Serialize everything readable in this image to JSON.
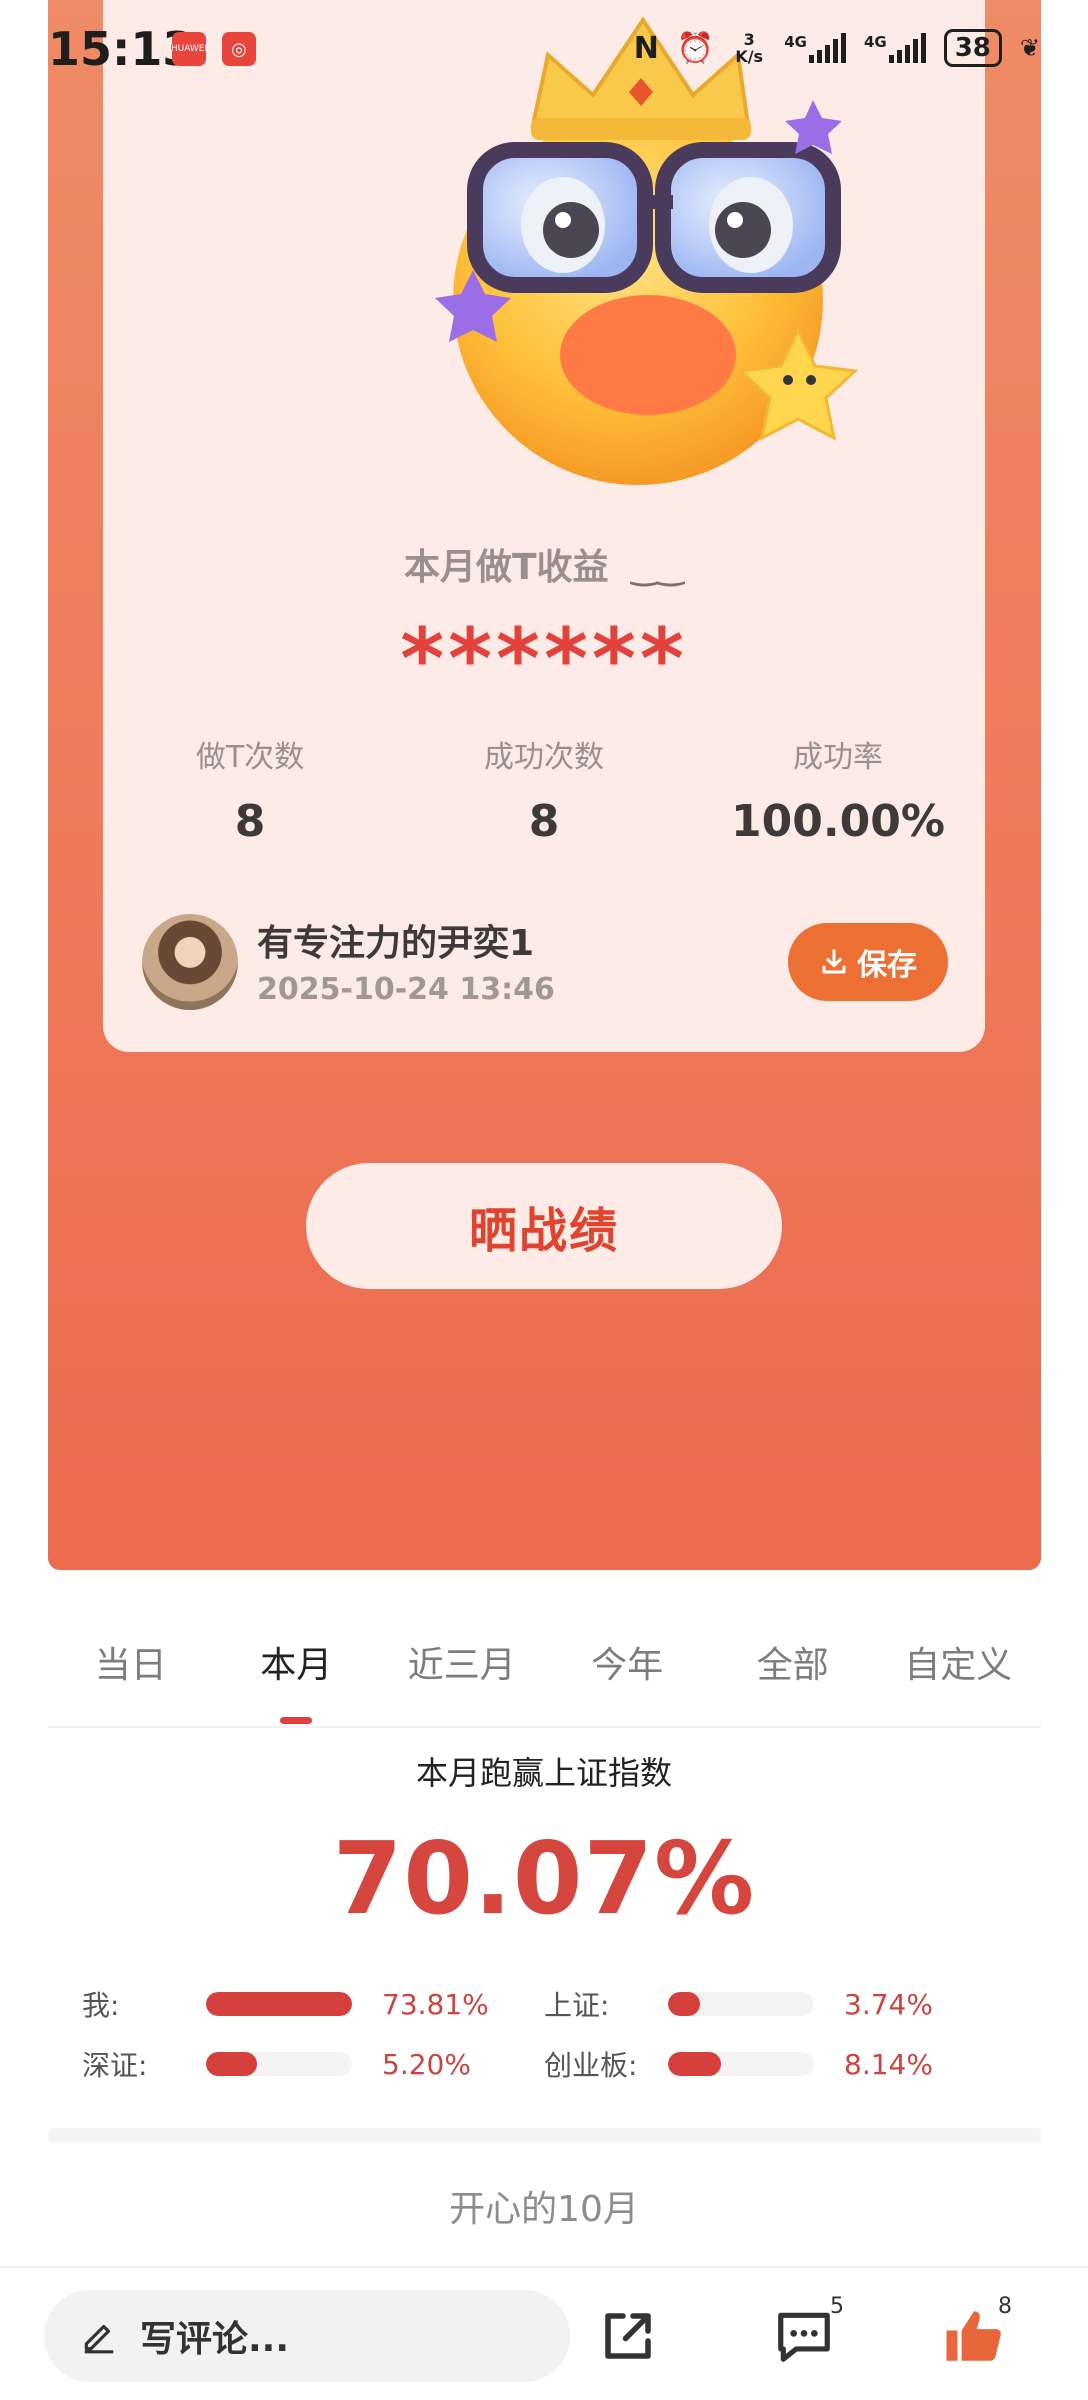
{
  "status_bar": {
    "time": "15:13",
    "app_badges": [
      "HUAWEI",
      "app"
    ],
    "speed": "3 K/s",
    "network_1": "4G",
    "network_2": "4G",
    "battery": "38"
  },
  "card": {
    "income_title": "本月做T收益",
    "income_value": "******",
    "stats": [
      {
        "label": "做T次数",
        "value": "8"
      },
      {
        "label": "成功次数",
        "value": "8"
      },
      {
        "label": "成功率",
        "value": "100.00%"
      }
    ],
    "user_name": "有专注力的尹奕1",
    "timestamp": "2025-10-24 13:46",
    "save_label": "保存"
  },
  "share_label": "晒战绩",
  "tabs": [
    {
      "label": "当日",
      "active": false
    },
    {
      "label": "本月",
      "active": true
    },
    {
      "label": "近三月",
      "active": false
    },
    {
      "label": "今年",
      "active": false
    },
    {
      "label": "全部",
      "active": false
    },
    {
      "label": "自定义",
      "active": false
    }
  ],
  "beat": {
    "title": "本月跑赢上证指数",
    "percent": "70.07%"
  },
  "comparisons": [
    {
      "label": "我:",
      "value": "73.81%",
      "fill": 1.0
    },
    {
      "label": "上证:",
      "value": "3.74%",
      "fill": 0.22
    },
    {
      "label": "深证:",
      "value": "5.20%",
      "fill": 0.35
    },
    {
      "label": "创业板:",
      "value": "8.14%",
      "fill": 0.36
    }
  ],
  "post_title": "开心的10月",
  "bottom_bar": {
    "comment_placeholder": "写评论...",
    "comment_count": "5",
    "like_count": "8"
  },
  "colors": {
    "accent_red": "#d5463f",
    "accent_orange": "#ec6f33",
    "poster_bg": "#ee7a5a",
    "card_bg": "#fcebe6"
  }
}
